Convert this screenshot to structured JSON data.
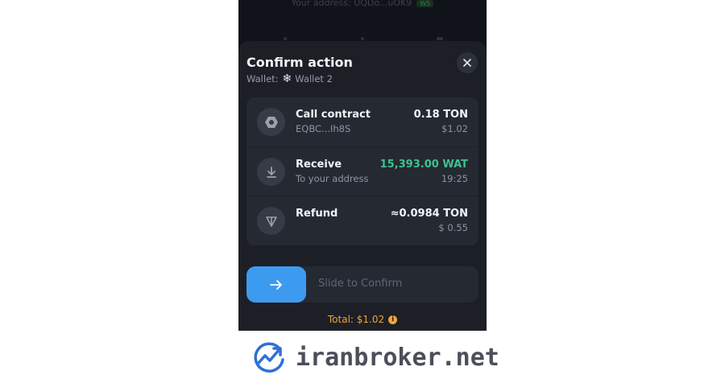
{
  "background": {
    "address_text": "Your address: UQDo...uOK9",
    "address_badge": "W5"
  },
  "sheet": {
    "title": "Confirm action",
    "wallet_prefix": "Wallet:",
    "wallet_icon": "snowflake-icon",
    "wallet_name": "Wallet 2",
    "close_icon": "close-icon"
  },
  "actions": [
    {
      "icon": "hexagon-contract-icon",
      "title": "Call contract",
      "subtitle": "EQBC...Ih8S",
      "amount": "0.18 TON",
      "fiat": "$1.02"
    },
    {
      "icon": "arrow-down-receive-icon",
      "title": "Receive",
      "subtitle": "To your address",
      "amount": "15,393.00 WAT",
      "fiat": "19:25",
      "amount_color": "#3ec28f"
    },
    {
      "icon": "ton-logo-icon",
      "title": "Refund",
      "subtitle": "",
      "amount": "≈0.0984 TON",
      "fiat": "$ 0.55"
    }
  ],
  "slider": {
    "label": "Slide to Confirm",
    "knob_icon": "arrow-right-icon"
  },
  "total": {
    "text": "Total: $1.02",
    "info_icon": "info-icon"
  },
  "brand": {
    "name": "iranbroker.net",
    "logo_icon": "growth-chart-logo"
  },
  "colors": {
    "accent_blue": "#3d9bef",
    "positive_green": "#3ec28f",
    "total_orange": "#f0a33b",
    "sheet_bg": "#1c1f26",
    "card_bg": "#252932"
  }
}
